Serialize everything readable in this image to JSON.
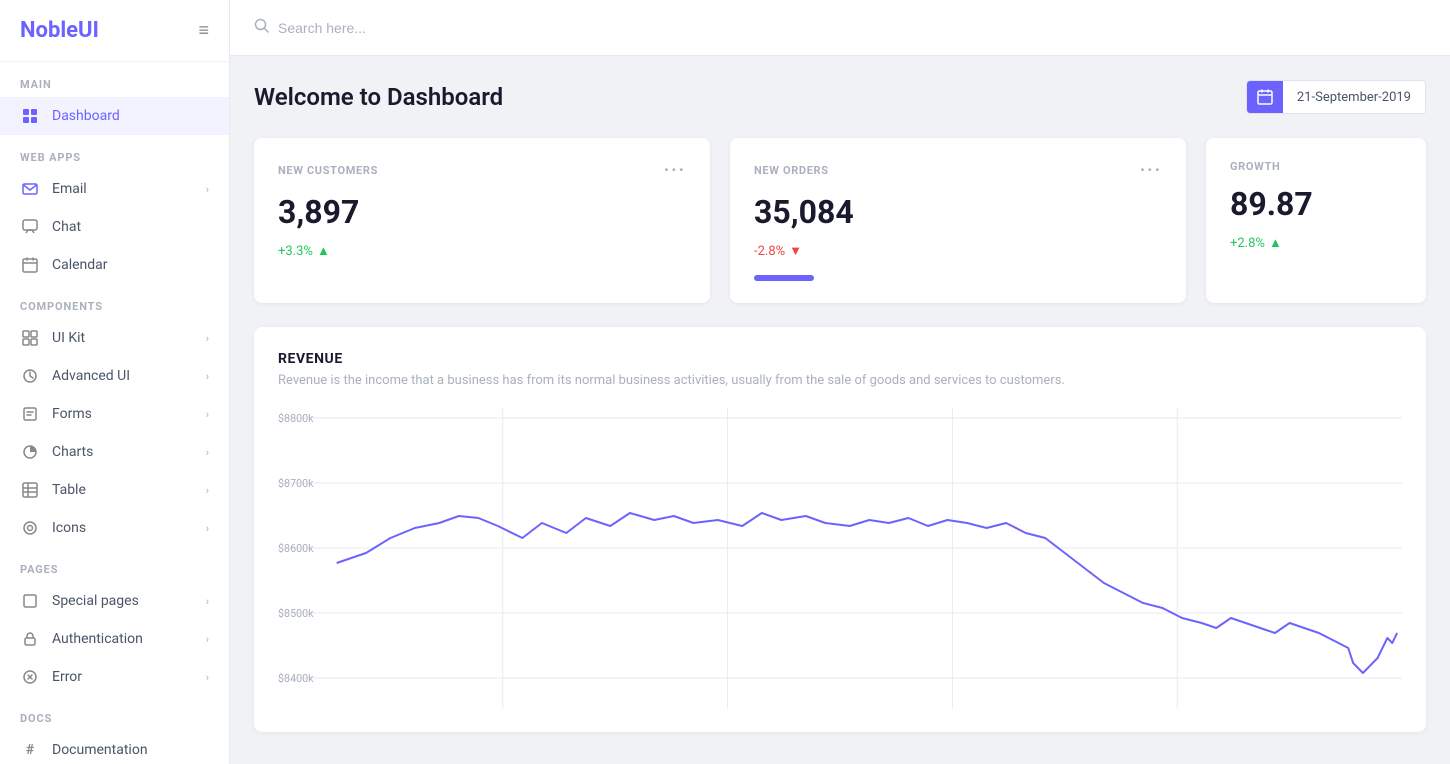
{
  "app": {
    "name_part1": "Noble",
    "name_part2": "UI"
  },
  "topbar": {
    "search_placeholder": "Search here..."
  },
  "sidebar": {
    "sections": [
      {
        "label": "MAIN",
        "items": [
          {
            "id": "dashboard",
            "label": "Dashboard",
            "icon": "dashboard",
            "active": true,
            "has_chevron": false
          }
        ]
      },
      {
        "label": "WEB APPS",
        "items": [
          {
            "id": "email",
            "label": "Email",
            "icon": "email",
            "active": false,
            "has_chevron": true
          },
          {
            "id": "chat",
            "label": "Chat",
            "icon": "chat",
            "active": false,
            "has_chevron": false
          },
          {
            "id": "calendar",
            "label": "Calendar",
            "icon": "calendar",
            "active": false,
            "has_chevron": false
          }
        ]
      },
      {
        "label": "COMPONENTS",
        "items": [
          {
            "id": "uikit",
            "label": "UI Kit",
            "icon": "uikit",
            "active": false,
            "has_chevron": true
          },
          {
            "id": "advanced",
            "label": "Advanced UI",
            "icon": "advanced",
            "active": false,
            "has_chevron": true
          },
          {
            "id": "forms",
            "label": "Forms",
            "icon": "forms",
            "active": false,
            "has_chevron": true
          },
          {
            "id": "charts",
            "label": "Charts",
            "icon": "charts",
            "active": false,
            "has_chevron": true
          },
          {
            "id": "table",
            "label": "Table",
            "icon": "table",
            "active": false,
            "has_chevron": true
          },
          {
            "id": "icons",
            "label": "Icons",
            "icon": "icons",
            "active": false,
            "has_chevron": true
          }
        ]
      },
      {
        "label": "PAGES",
        "items": [
          {
            "id": "special",
            "label": "Special pages",
            "icon": "special",
            "active": false,
            "has_chevron": true
          },
          {
            "id": "auth",
            "label": "Authentication",
            "icon": "auth",
            "active": false,
            "has_chevron": true
          },
          {
            "id": "error",
            "label": "Error",
            "icon": "error",
            "active": false,
            "has_chevron": true
          }
        ]
      },
      {
        "label": "DOCS",
        "items": [
          {
            "id": "docs",
            "label": "Documentation",
            "icon": "docs",
            "active": false,
            "has_chevron": false
          }
        ]
      }
    ]
  },
  "page": {
    "title": "Welcome to Dashboard",
    "date": "21-September-2019"
  },
  "stats": [
    {
      "id": "new-customers",
      "label": "NEW CUSTOMERS",
      "value": "3,897",
      "change": "+3.3%",
      "change_type": "positive",
      "has_dots": true
    },
    {
      "id": "new-orders",
      "label": "NEW ORDERS",
      "value": "35,084",
      "change": "-2.8%",
      "change_type": "negative",
      "has_dots": true
    },
    {
      "id": "growth",
      "label": "GROWTH",
      "value": "89.87",
      "change": "+2.8%",
      "change_type": "positive",
      "has_dots": false
    }
  ],
  "revenue": {
    "title": "REVENUE",
    "description": "Revenue is the income that a business has from its normal business activities, usually from the sale of goods and services to customers.",
    "y_labels": [
      "$8800k",
      "$8700k",
      "$8600k",
      "$8500k",
      "$8400k"
    ],
    "chart_color": "#6c63ff"
  }
}
